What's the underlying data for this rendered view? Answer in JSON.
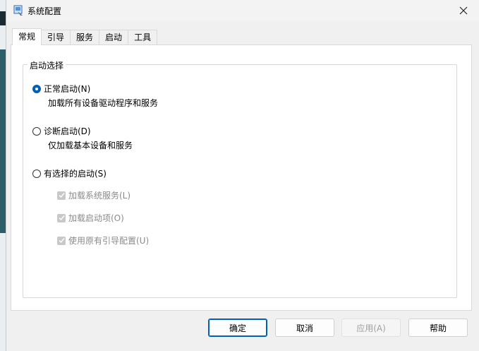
{
  "window": {
    "title": "系统配置"
  },
  "tabs": [
    {
      "label": "常规",
      "active": true
    },
    {
      "label": "引导",
      "active": false
    },
    {
      "label": "服务",
      "active": false
    },
    {
      "label": "启动",
      "active": false
    },
    {
      "label": "工具",
      "active": false
    }
  ],
  "startup_group": {
    "label": "启动选择",
    "normal": {
      "label": "正常启动(N)",
      "desc": "加载所有设备驱动程序和服务",
      "checked": true
    },
    "diagnostic": {
      "label": "诊断启动(D)",
      "desc": "仅加载基本设备和服务",
      "checked": false
    },
    "selective": {
      "label": "有选择的启动(S)",
      "checked": false,
      "options": [
        {
          "label": "加载系统服务(L)",
          "checked": true,
          "disabled": true
        },
        {
          "label": "加载启动项(O)",
          "checked": true,
          "disabled": true
        },
        {
          "label": "使用原有引导配置(U)",
          "checked": true,
          "disabled": true
        }
      ]
    }
  },
  "buttons": {
    "ok": "确定",
    "cancel": "取消",
    "apply": "应用(A)",
    "help": "帮助"
  },
  "colors": {
    "accent": "#005fb8"
  }
}
